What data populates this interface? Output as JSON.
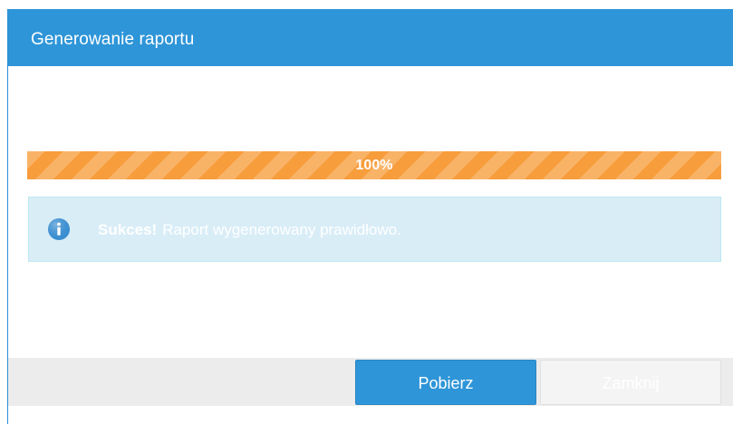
{
  "dialog": {
    "title": "Generowanie raportu"
  },
  "progress": {
    "value_percent": 100,
    "label": "100%",
    "color": "#f79d3c"
  },
  "alert": {
    "icon": "info-icon",
    "strong": "Sukces!",
    "message": "Raport wygenerowany prawidłowo."
  },
  "footer": {
    "download_label": "Pobierz",
    "close_label": "Zamknij"
  },
  "colors": {
    "accent": "#2e95d8",
    "alert_bg": "#d9edf7",
    "progress": "#f79d3c"
  }
}
